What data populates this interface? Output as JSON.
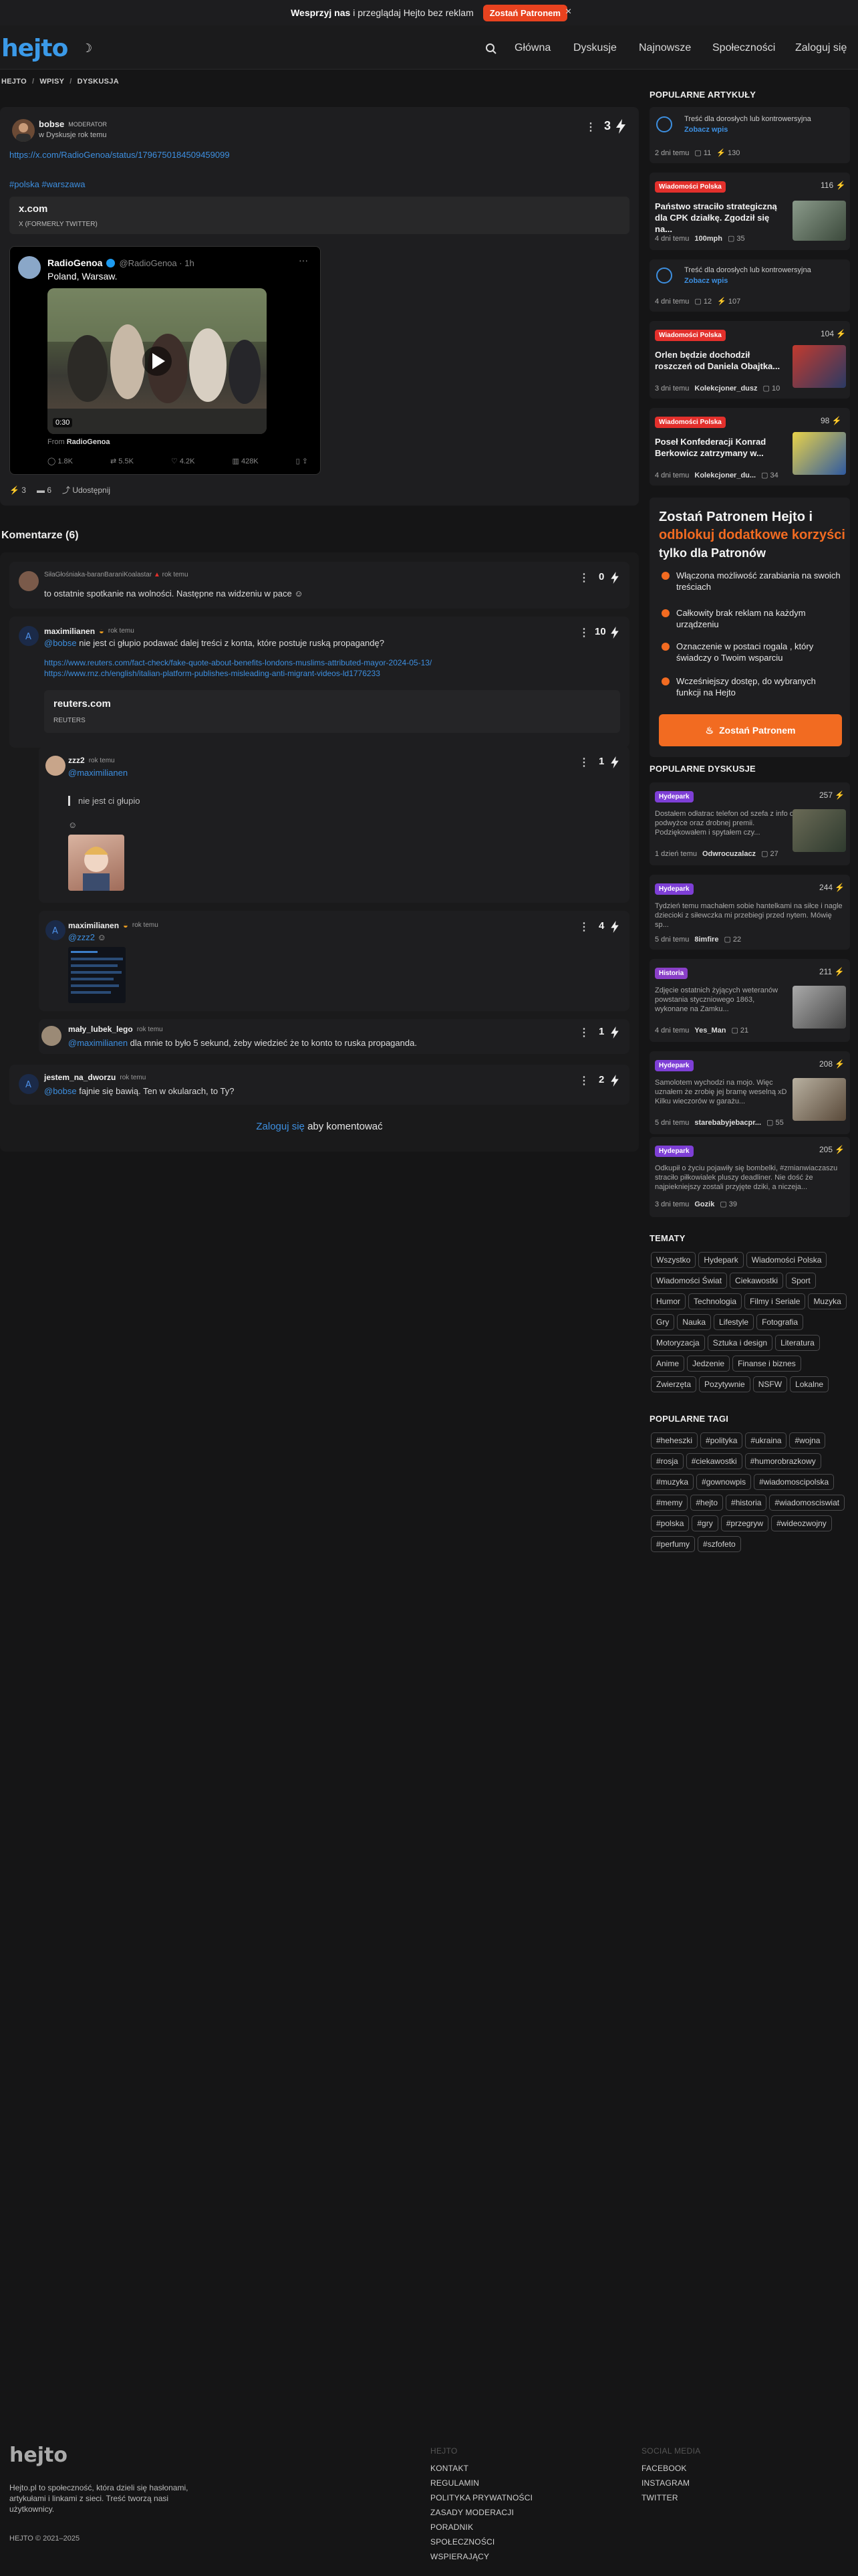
{
  "banner": {
    "text_bold": "Wesprzyj nas",
    "text_rest": " i przeglądaj Hejto bez reklam",
    "cta": "Zostań Patronem",
    "close": "×"
  },
  "header": {
    "logo": "hejto",
    "nav": [
      "Główna",
      "Dyskusje",
      "Najnowsze",
      "Społeczności",
      "Zaloguj się"
    ]
  },
  "breadcrumb": [
    "HEJTO",
    "/",
    "WPISY",
    "/",
    "DYSKUSJA"
  ],
  "post": {
    "author": "bobse",
    "role": "MODERATOR",
    "community": "w Dyskusje",
    "time": "rok temu",
    "score": "3",
    "url": "https://x.com/RadioGenoa/status/1796750184509459099",
    "tags": "#polska #warszawa",
    "embed_title": "x.com",
    "embed_sub": "X (FORMERLY TWITTER)",
    "tweet": {
      "name": "RadioGenoa",
      "handle": "@RadioGenoa · 1h",
      "text": "Poland, Warsaw.",
      "duration": "0:30",
      "from": "From",
      "from_name": "RadioGenoa",
      "replies": "1.8K",
      "retweets": "5.5K",
      "likes": "4.2K",
      "views": "428K"
    },
    "footer": {
      "likes": "3",
      "comments": "6",
      "share": "Udostępnij"
    }
  },
  "comments_header": "Komentarze (6)",
  "comments": [
    {
      "author": "SiłaGłośniaka-baranBaraniKoalastar",
      "time": "rok temu",
      "score": "0",
      "text": "to ostatnie spotkanie na wolności. Następne na widzeniu w pace"
    },
    {
      "author": "maximilianen",
      "time": "rok temu",
      "score": "10",
      "mention": "@bobse",
      "text": " nie jest ci głupio podawać dalej treści z konta, które postuje ruską propagandę?",
      "links": [
        "https://www.reuters.com/fact-check/fake-quote-about-benefits-londons-muslims-attributed-mayor-2024-05-13/",
        "https://www.rnz.ch/english/italian-platform-publishes-misleading-anti-migrant-videos-ld1776233"
      ],
      "embed_title": "reuters.com",
      "embed_sub": "REUTERS"
    },
    {
      "author": "zzz2",
      "time": "rok temu",
      "score": "1",
      "mention": "@maximilianen",
      "quote": "nie jest ci głupio"
    },
    {
      "author": "maximilianen",
      "time": "rok temu",
      "score": "4",
      "mention": "@zzz2"
    },
    {
      "author": "mały_lubek_lego",
      "time": "rok temu",
      "score": "1",
      "mention": "@maximilianen",
      "text": " dla mnie to było 5 sekund, żeby wiedzieć że to konto to ruska propaganda."
    },
    {
      "author": "jestem_na_dworzu",
      "time": "rok temu",
      "score": "2",
      "mention": "@bobse",
      "text": " fajnie się bawią. Ten w okularach, to Ty?"
    }
  ],
  "login_prompt": {
    "link": "Zaloguj się",
    "rest": " aby komentować"
  },
  "sidebar": {
    "popular_articles_title": "POPULARNE ARTYKUŁY",
    "articles": [
      {
        "nsfw": "Treść dla dorosłych lub kontrowersyjna",
        "show": "Zobacz wpis",
        "time": "2 dni temu",
        "comments": "11",
        "likes": "130"
      },
      {
        "tag": "Wiadomości Polska",
        "score": "116",
        "title": "Państwo straciło strategiczną dla CPK działkę. Zgodził się na...",
        "time": "4 dni temu",
        "author": "100mph",
        "comments": "35"
      },
      {
        "nsfw": "Treść dla dorosłych lub kontrowersyjna",
        "show": "Zobacz wpis",
        "time": "4 dni temu",
        "comments": "12",
        "likes": "107"
      },
      {
        "tag": "Wiadomości Polska",
        "score": "104",
        "title": "Orlen będzie dochodził roszczeń od Daniela Obajtka...",
        "time": "3 dni temu",
        "author": "Kolekcjoner_dusz",
        "comments": "10"
      },
      {
        "tag": "Wiadomości Polska",
        "score": "98",
        "title": "Poseł Konfederacji Konrad Berkowicz zatrzymany w...",
        "time": "4 dni temu",
        "author": "Kolekcjoner_du...",
        "comments": "34"
      }
    ],
    "patron": {
      "line1": "Zostań Patronem Hejto i",
      "line2": "odblokuj dodatkowe korzyści",
      "line3": "tylko dla Patronów",
      "benefits": [
        "Włączona możliwość zarabiania na swoich treściach",
        "Całkowity brak reklam na każdym urządzeniu",
        "Oznaczenie w postaci rogala , który świadczy o Twoim wsparciu",
        "Wcześniejszy dostęp, do wybranych funkcji na Hejto"
      ],
      "cta": "Zostań Patronem"
    },
    "popular_discussions_title": "POPULARNE DYSKUSJE",
    "discussions": [
      {
        "tag": "Hydepark",
        "score": "257",
        "text": "Dostałem odłatrac telefon od szefa z info o podwyżce oraz drobnej premii. Podziękowałem i spytałem czy...",
        "time": "1 dzień temu",
        "author": "Odwrocuzalacz",
        "comments": "27"
      },
      {
        "tag": "Hydepark",
        "score": "244",
        "text": "Tydzień temu machałem sobie hantelkami na siłce i nagle dziecioki z siłewczka mi przebiegi przed nytem. Mówię sp...",
        "time": "5 dni temu",
        "author": "8imfire",
        "comments": "22"
      },
      {
        "tag": "Historia",
        "score": "211",
        "text": "Zdjęcie ostatnich żyjących weteranów powstania styczniowego 1863, wykonane na Zamku...",
        "time": "4 dni temu",
        "author": "Yes_Man",
        "comments": "21"
      },
      {
        "tag": "Hydepark",
        "score": "208",
        "text": "Samolotem wychodzi na mojo. Więc uznałem że zrobię jej bramę weselną xD Kilku wieczorów w garażu...",
        "time": "5 dni temu",
        "author": "starebabyjebacpr...",
        "comments": "55"
      },
      {
        "tag": "Hydepark",
        "score": "205",
        "text": "Odkupił o życiu pojawiły się bombelki, #zmianwiaczaszu straciło piłkowialek pluszy deadliner. Nie dość że najpiekniejszy zostali przyjęte dziki, a niczeja...",
        "time": "3 dni temu",
        "author": "Gozik",
        "comments": "39"
      }
    ],
    "topics_title": "TEMATY",
    "topics": [
      "Wszystko",
      "Hydepark",
      "Wiadomości Polska",
      "Wiadomości Świat",
      "Ciekawostki",
      "Sport",
      "Humor",
      "Technologia",
      "Filmy i Seriale",
      "Muzyka",
      "Gry",
      "Nauka",
      "Lifestyle",
      "Fotografia",
      "Motoryzacja",
      "Sztuka i design",
      "Literatura",
      "Anime",
      "Jedzenie",
      "Finanse i biznes",
      "Zwierzęta",
      "Pozytywnie",
      "NSFW",
      "Lokalne"
    ],
    "tags_title": "POPULARNE TAGI",
    "tags": [
      "#heheszki",
      "#polityka",
      "#ukraina",
      "#wojna",
      "#rosja",
      "#ciekawostki",
      "#humorobrazkowy",
      "#muzyka",
      "#gownowpis",
      "#wiadomoscipolska",
      "#memy",
      "#hejto",
      "#historia",
      "#wiadomosciswiat",
      "#polska",
      "#gry",
      "#przegryw",
      "#wideozwojny",
      "#perfumy",
      "#szfofeto"
    ]
  },
  "footer": {
    "logo": "hejto",
    "desc": "Hejto.pl to społeczność, która dzieli się hasłonami, artykułami i linkami z sieci. Treść tworzą nasi użytkownicy.",
    "copy": "HEJTO © 2021–2025",
    "col1_title": "HEJTO",
    "col1": [
      "KONTAKT",
      "REGULAMIN",
      "POLITYKA PRYWATNOŚCI",
      "ZASADY MODERACJI",
      "PORADNIK",
      "SPOŁECZNOŚCI",
      "WSPIERAJĄCY"
    ],
    "col2_title": "SOCIAL MEDIA",
    "col2": [
      "FACEBOOK",
      "INSTAGRAM",
      "TWITTER"
    ]
  }
}
